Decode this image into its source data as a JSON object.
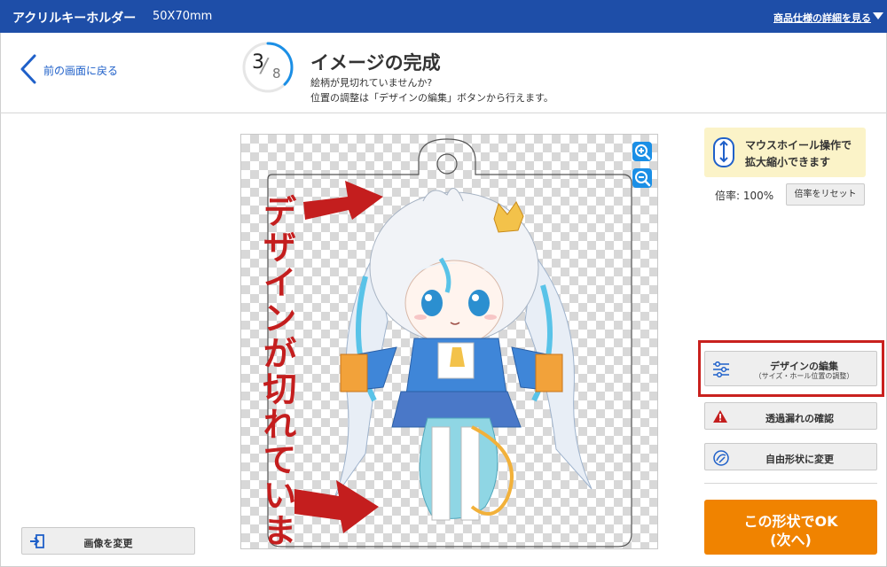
{
  "topbar": {
    "product": "アクリルキーホルダー",
    "size": "50X70mm",
    "detail_link": "商品仕様の詳細を見る",
    "caret_icon": "caret-down-icon"
  },
  "header": {
    "back_label": "前の画面に戻る",
    "step_current": "3",
    "step_total": "8",
    "step_progress": 0.375,
    "title": "イメージの完成",
    "subtitle_1": "絵柄が見切れていませんか?",
    "subtitle_2": "位置の調整は「デザインの編集」ボタンから行えます。"
  },
  "canvas": {
    "annotation_text": "デザインが切れています",
    "zoom_in_icon": "zoom-in-icon",
    "zoom_out_icon": "zoom-out-icon"
  },
  "left_panel": {
    "change_image_label": "画像を変更"
  },
  "right_panel": {
    "mouse_tip_line1": "マウスホイール操作で",
    "mouse_tip_line2": "拡大縮小できます",
    "zoom_label": "倍率: 100%",
    "reset_label": "倍率をリセット",
    "edit_label": "デザインの編集",
    "edit_sublabel": "（サイズ・ホール位置の調整）",
    "check_label": "透過漏れの確認",
    "free_shape_label": "自由形状に変更",
    "ok_line1": "この形状でOK",
    "ok_line2": "(次へ)"
  },
  "colors": {
    "topbar": "#1e4ea8",
    "accent_blue": "#1b8fe6",
    "warning_red": "#c41e1e",
    "ok_orange": "#f08300",
    "tip_yellow": "#fbf3c8"
  }
}
